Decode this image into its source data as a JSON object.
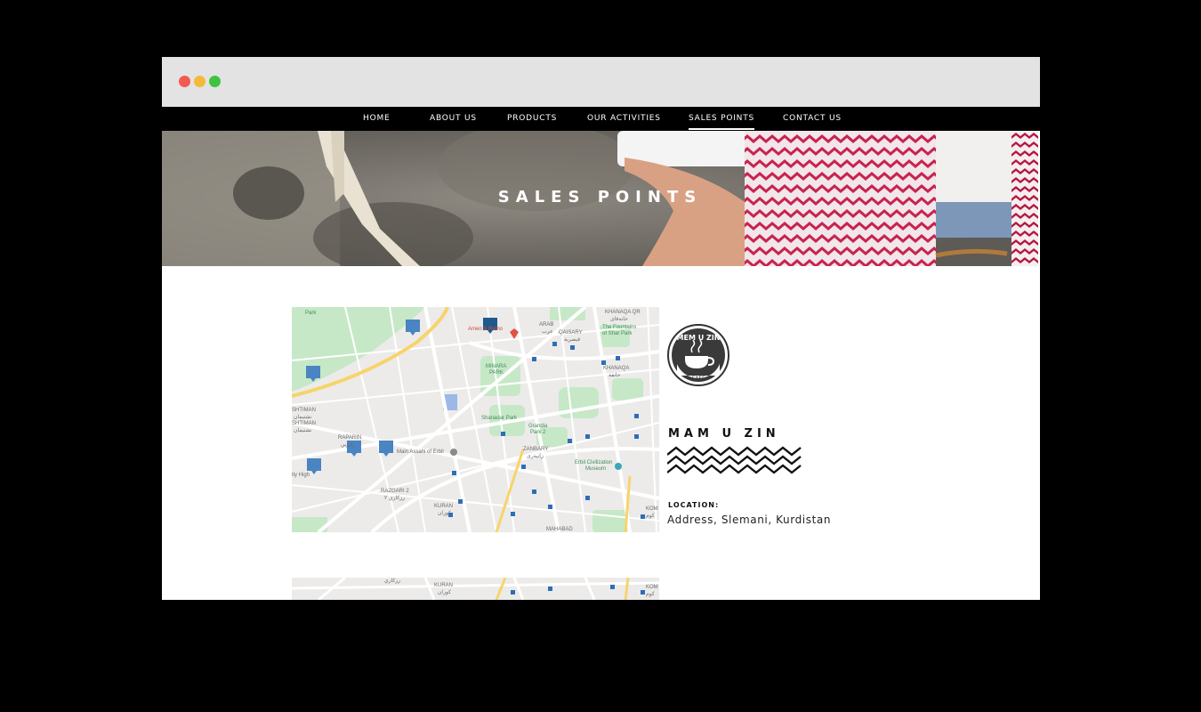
{
  "browser": {
    "dots": [
      "close",
      "minimize",
      "maximize"
    ]
  },
  "nav": {
    "items": [
      {
        "label": "HOME"
      },
      {
        "label": "ABOUT US"
      },
      {
        "label": "PRODUCTS"
      },
      {
        "label": "OUR ACTIVITIES"
      },
      {
        "label": "SALES POINTS",
        "active": true
      },
      {
        "label": "CONTACT US"
      }
    ]
  },
  "hero": {
    "title": "SALES POINTS"
  },
  "map1": {
    "labels": {
      "khanaqa_qr": "KHANAQA QR",
      "khanaqa_qr_ar": "خانەقای",
      "arab": "ARAB",
      "arab_ar": "عرب",
      "qaisary": "QAISARY",
      "qaisary_ar": "قيصرية",
      "park": "Park",
      "fountains": "The Fountains",
      "fountains2": "of Shar Park",
      "amenities": "Amen  & Retno",
      "minara_park": "MINARA",
      "minara_park2": "PARK",
      "khanaqa": "KHANAQA",
      "khanaqa_ar": "خانقة",
      "ishtiman1": "SHTIMAN",
      "ishtiman1_ar": "نشتيمان",
      "ishtiman2": "SHTIMAN",
      "ishtiman2_ar": "نشتيمان",
      "shanadar": "Shanadar Park",
      "grandpark": "Grandia",
      "grandpark2": "Park 2",
      "raparin": "RAPARIN",
      "raparin_ar": "رابرين",
      "zanbary": "ZANBARY",
      "zanbary_ar": "زانبەری",
      "masjid": "Main Assahi of Erbil",
      "civil": "Erbil Civilization",
      "civil2": "Museum",
      "ity_high": "ity High",
      "razgari": "RAZGARI 2",
      "razgari_ar": "رزكاري ٢",
      "kuran": "KURAN",
      "kuran_ar": "كوران",
      "kom": "KOM",
      "kom_ar": "كوم",
      "mahabad": "MAHABAD"
    }
  },
  "map2": {
    "labels": {
      "razgari_ar": "رزكاري",
      "kuran": "KURAN",
      "kuran_ar": "كوران",
      "kom": "KOM",
      "kom_ar": "كوم"
    }
  },
  "store": {
    "logo_text_top": "MEM U ZIN",
    "logo_text_bottom": "CAFE",
    "name": "MAM U ZIN",
    "location_label": "LOCATION:",
    "location_value": "Address, Slemani, Kurdistan"
  },
  "colors": {
    "nav_bg": "#000000",
    "titlebar": "#e3e3e3",
    "dot_red": "#f25a52",
    "dot_yellow": "#f5b93a",
    "dot_green": "#3ec43f",
    "map_park": "#c6e8c7",
    "map_road_major": "#f7d46b"
  }
}
